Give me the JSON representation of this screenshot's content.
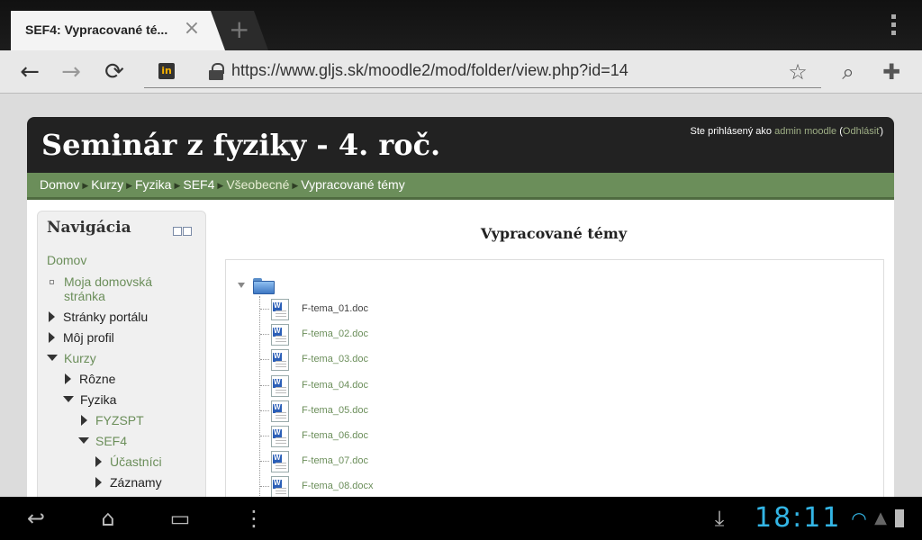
{
  "browser": {
    "tab_title": "SEF4: Vypracované té...",
    "tab_close": "×",
    "new_tab": "+",
    "back": "←",
    "forward": "→",
    "reload": "⟳",
    "favicon": "in",
    "url": "https://www.gljs.sk/moodle2/mod/folder/view.php?id=14",
    "star": "☆",
    "search": "⌕",
    "bookmarks": "✚"
  },
  "site": {
    "title": "Seminár z fyziky - 4. roč.",
    "login_prefix": "Ste prihlásený ako ",
    "login_user": "admin moodle",
    "login_paren_open": " (",
    "login_logout": "Odhlásiť",
    "login_paren_close": ")"
  },
  "breadcrumb": {
    "items": [
      "Domov",
      "Kurzy",
      "Fyzika",
      "SEF4",
      "Všeobecné",
      "Vypracované témy"
    ],
    "separator": "▶"
  },
  "navigation": {
    "heading": "Navigácia",
    "items": [
      {
        "label": "Domov"
      },
      {
        "label": "Moja domovská"
      },
      {
        "label": "stránka"
      },
      {
        "label": "Stránky portálu"
      },
      {
        "label": "Môj profil"
      },
      {
        "label": "Kurzy"
      },
      {
        "label": "Rôzne"
      },
      {
        "label": "Fyzika"
      },
      {
        "label": "FYZSPT"
      },
      {
        "label": "SEF4"
      },
      {
        "label": "Účastníci"
      },
      {
        "label": "Záznamy"
      }
    ]
  },
  "main": {
    "title": "Vypracované témy",
    "files": [
      {
        "name": "F-tema_01.doc"
      },
      {
        "name": "F-tema_02.doc"
      },
      {
        "name": "F-tema_03.doc"
      },
      {
        "name": "F-tema_04.doc"
      },
      {
        "name": "F-tema_05.doc"
      },
      {
        "name": "F-tema_06.doc"
      },
      {
        "name": "F-tema_07.doc"
      },
      {
        "name": "F-tema_08.docx"
      }
    ]
  },
  "system": {
    "back": "↩",
    "home": "⌂",
    "recents": "▭",
    "menu": "⋮",
    "download": "⤓",
    "clock": "18:11",
    "status": "▲"
  },
  "colors": {
    "accent_green": "#6b8e5a",
    "header_dark": "#222222",
    "clock_blue": "#33b5e5"
  }
}
